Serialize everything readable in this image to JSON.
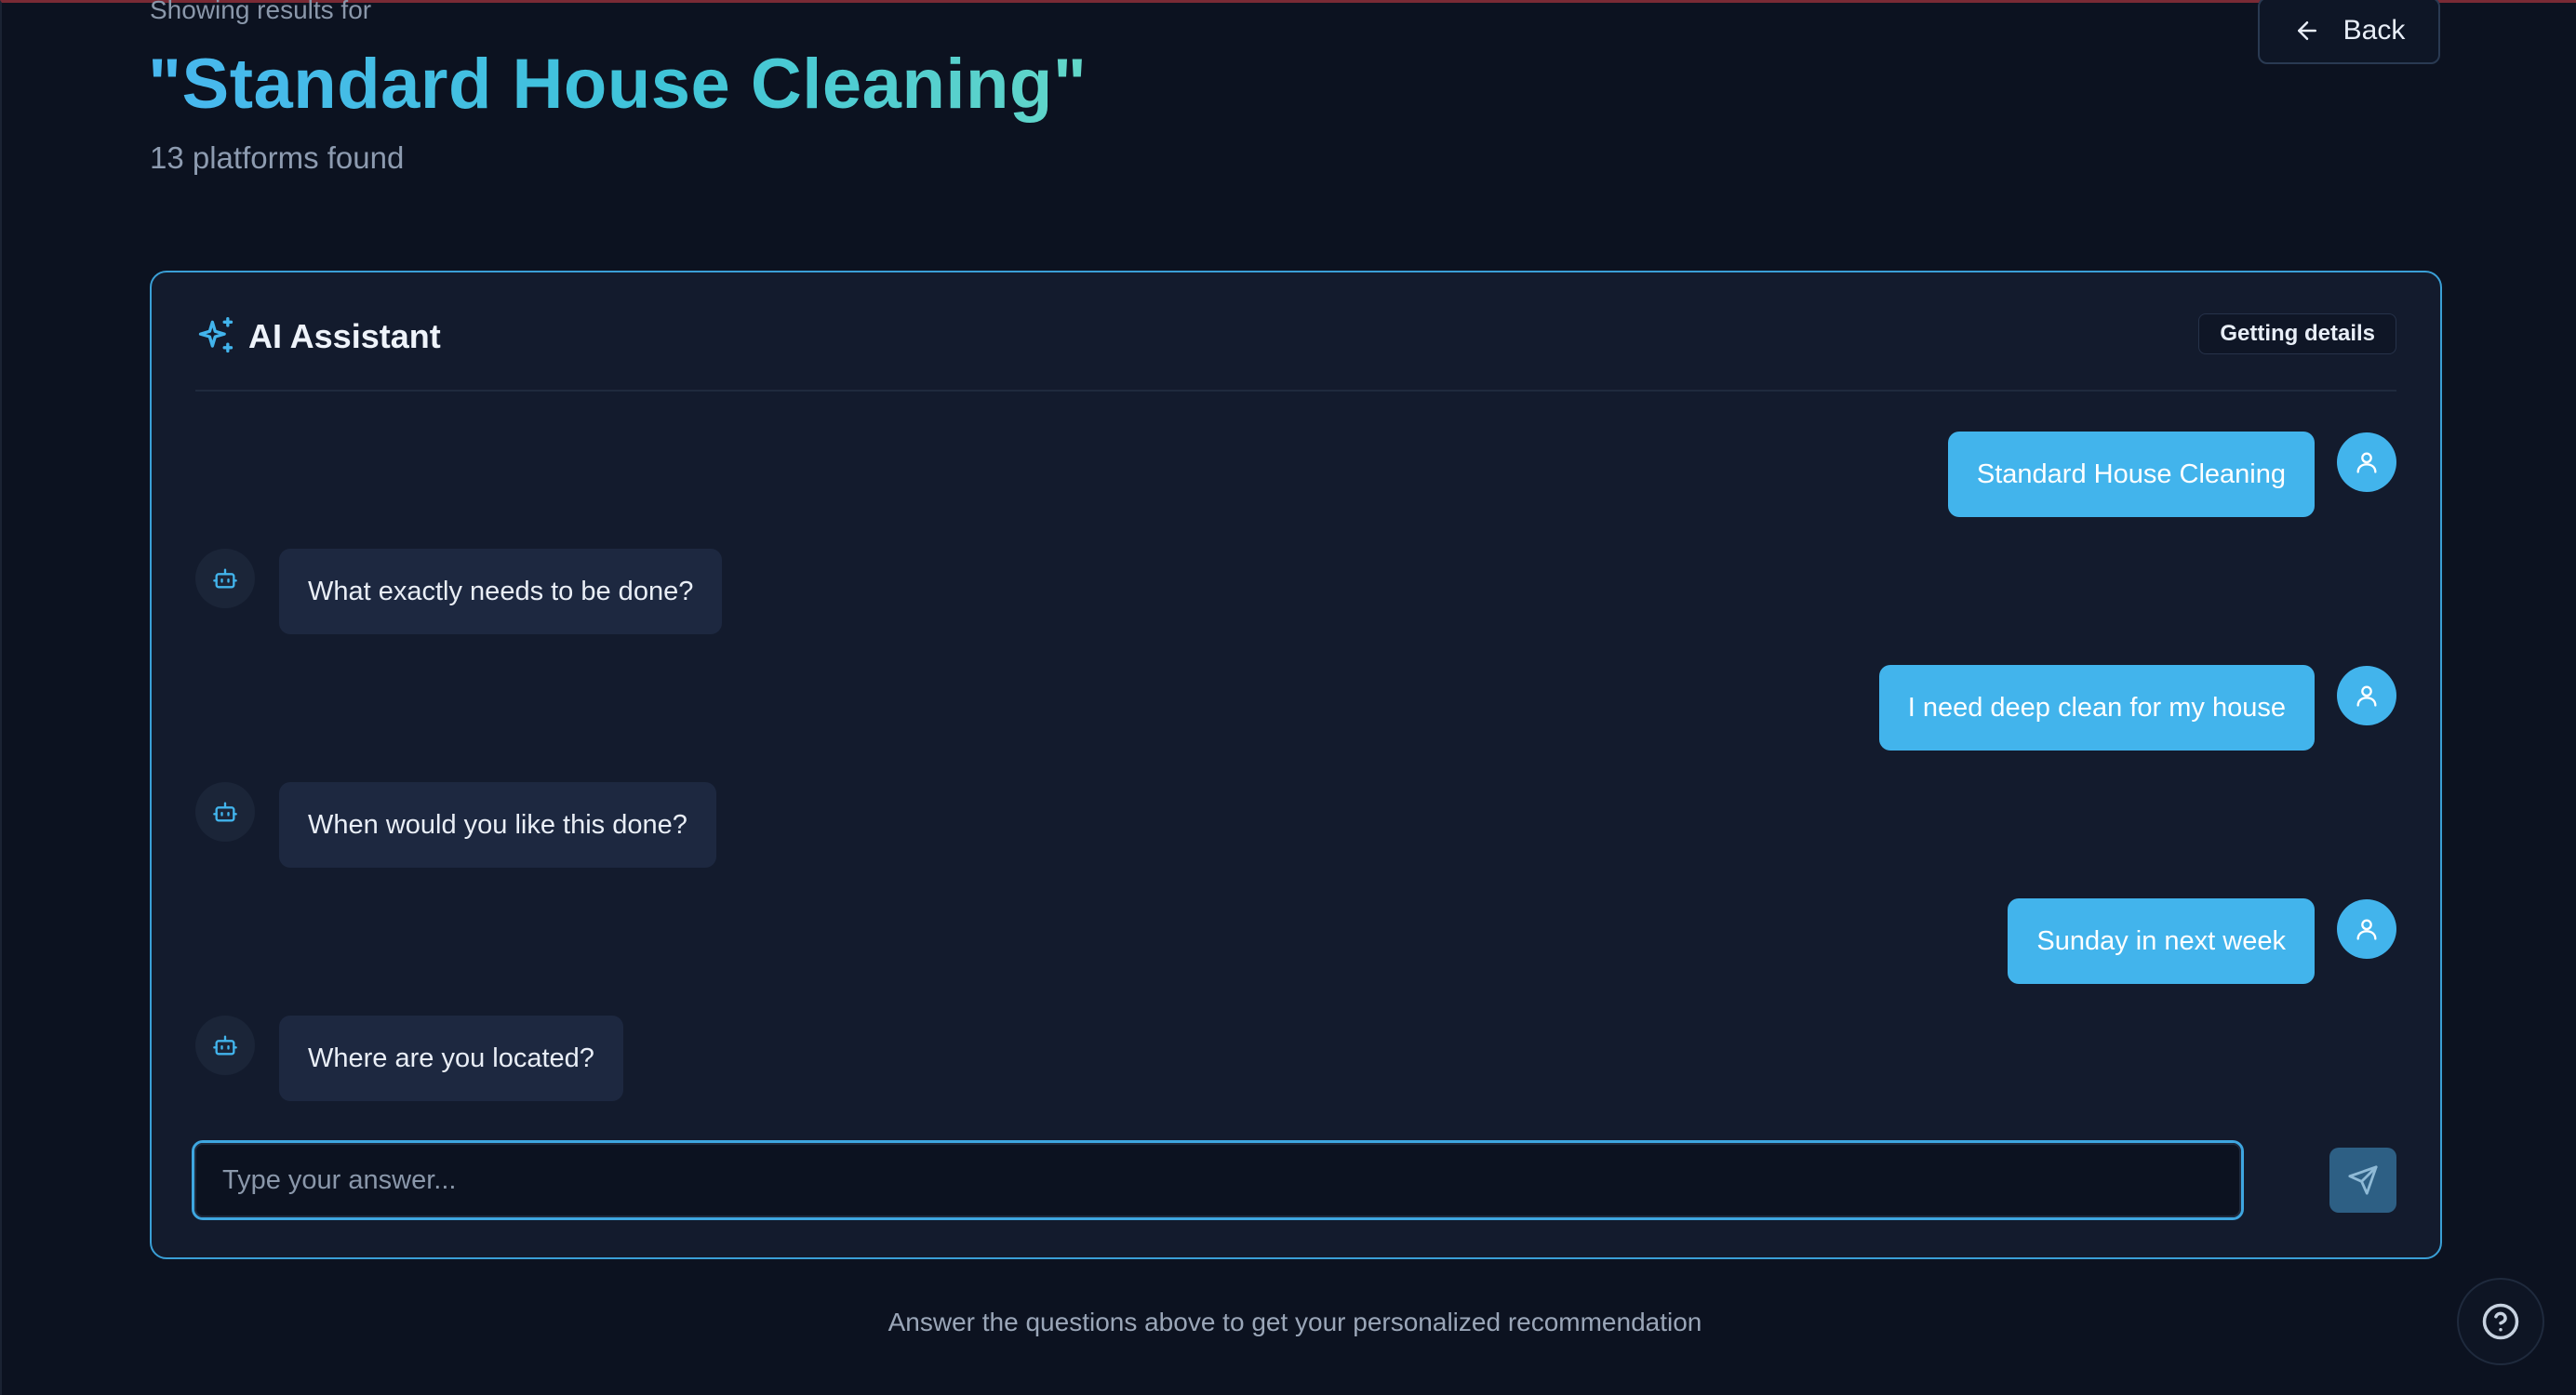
{
  "header": {
    "subtitle": "Showing results for",
    "title": "\"Standard House Cleaning\"",
    "result_count": "13 platforms found",
    "back_label": "Back"
  },
  "assistant": {
    "title": "AI Assistant",
    "status": "Getting details",
    "messages": [
      {
        "role": "user",
        "text": "Standard House Cleaning"
      },
      {
        "role": "bot",
        "text": "What exactly needs to be done?"
      },
      {
        "role": "user",
        "text": "I need deep clean for my house"
      },
      {
        "role": "bot",
        "text": "When would you like this done?"
      },
      {
        "role": "user",
        "text": "Sunday in next week"
      },
      {
        "role": "bot",
        "text": "Where are you located?"
      }
    ],
    "input": {
      "value": "",
      "placeholder": "Type your answer..."
    }
  },
  "footer": {
    "hint": "Answer the questions above to get your personalized recommendation"
  },
  "icons": {
    "back": "arrow-left-icon",
    "assistant": "sparkles-icon",
    "user_avatar": "user-icon",
    "bot_avatar": "bot-icon",
    "send": "send-icon",
    "help": "help-circle-icon"
  },
  "colors": {
    "background": "#0c1220",
    "card": "#131b2d",
    "accent": "#42b4ec",
    "card_border": "#3a9fd6",
    "bot_bubble": "#1d2840",
    "send_button": "#2d5f84"
  }
}
